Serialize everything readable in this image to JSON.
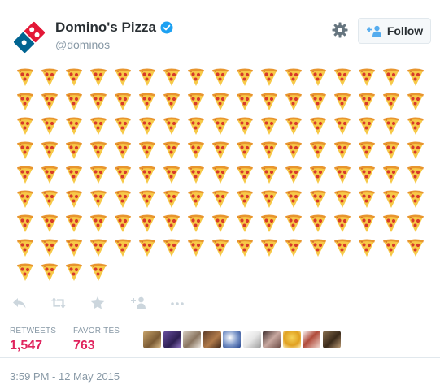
{
  "account": {
    "display_name": "Domino's Pizza",
    "handle": "@dominos",
    "verified": true
  },
  "header": {
    "follow_label": "Follow",
    "icons": [
      "dominos-logo",
      "verified-icon",
      "gear-icon",
      "follow-person-plus-icon"
    ]
  },
  "tweet": {
    "pizza_emoji_count": 140,
    "emoji_name": "pizza-slice"
  },
  "actions": [
    "reply-icon",
    "retweet-icon",
    "favorite-star-icon",
    "follow-plus-icon",
    "more-icon"
  ],
  "stats": {
    "retweets_label": "RETWEETS",
    "retweets_value": "1,547",
    "favorites_label": "FAVORITES",
    "favorites_value": "763",
    "favorited_by_avatar_count": 10
  },
  "timestamp": "3:59 PM - 12 May 2015",
  "colors": {
    "follow_icon": "#55acee",
    "verified": "#1da1f2",
    "stat_value": "#e0245e",
    "muted_text": "#8899a6",
    "dominos_blue": "#006491",
    "dominos_red": "#e31837"
  }
}
